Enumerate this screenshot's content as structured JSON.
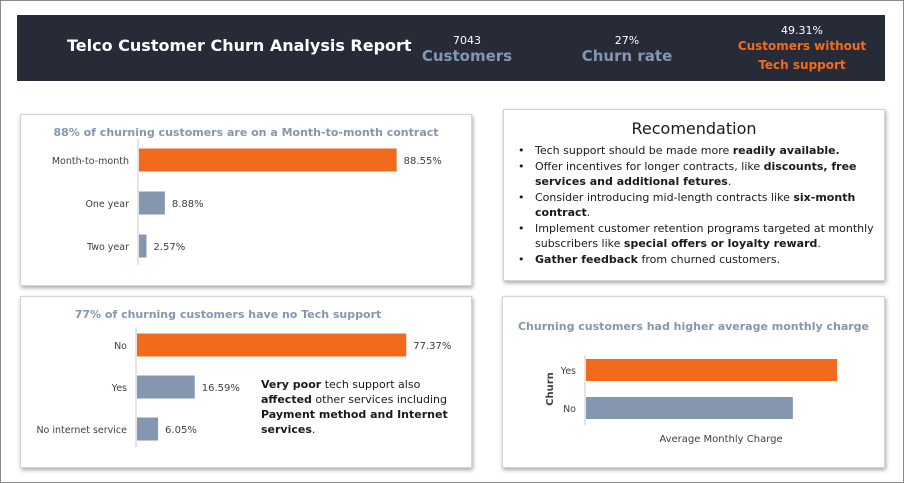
{
  "header": {
    "title": "Telco Customer Churn Analysis Report",
    "kpis": [
      {
        "value": "7043",
        "label": "Customers"
      },
      {
        "value": "27%",
        "label": "Churn rate"
      },
      {
        "value": "49.31%",
        "label_line1": "Customers without",
        "label_line2": "Tech support"
      }
    ]
  },
  "recommendation": {
    "title": "Recomendation",
    "items": [
      {
        "pre": "Tech support should be made more ",
        "bold": "readily available.",
        "post": ""
      },
      {
        "pre": "Offer incentives for longer contracts, like ",
        "bold": "discounts, free services and additional fetures",
        "post": "."
      },
      {
        "pre": "Consider introducing mid-length contracts like ",
        "bold": "six-month contract",
        "post": "."
      },
      {
        "pre": "Implement customer retention programs targeted at monthly subscribers like ",
        "bold": "special offers or loyalty reward",
        "post": "."
      },
      {
        "pre": "",
        "bold": "Gather feedback",
        "post": " from churned customers."
      }
    ]
  },
  "tech_note": {
    "b1": "Very poor",
    "t1": " tech support also ",
    "b2": "affected",
    "t2": " other services including ",
    "b3": "Payment method and Internet services",
    "t3": "."
  },
  "colors": {
    "highlight": "#f26b1d",
    "base": "#8496b0",
    "header_bg": "#262b37"
  },
  "chart_data": [
    {
      "type": "bar",
      "orientation": "horizontal",
      "title": "88% of churning customers are on a Month-to-month contract",
      "categories": [
        "Month-to-month",
        "One year",
        "Two year"
      ],
      "values": [
        88.55,
        8.88,
        2.57
      ],
      "labels": [
        "88.55%",
        "8.88%",
        "2.57%"
      ],
      "xlim": [
        0,
        100
      ],
      "grid": false
    },
    {
      "type": "bar",
      "orientation": "horizontal",
      "title": "77% of churning customers have no Tech support",
      "categories": [
        "No",
        "Yes",
        "No internet service"
      ],
      "values": [
        77.37,
        16.59,
        6.05
      ],
      "labels": [
        "77.37%",
        "16.59%",
        "6.05%"
      ],
      "xlim": [
        0,
        100
      ],
      "grid": false
    },
    {
      "type": "bar",
      "orientation": "horizontal",
      "title": "Churning customers had higher average monthly charge",
      "categories": [
        "Yes",
        "No"
      ],
      "values": [
        74.4,
        61.3
      ],
      "xlabel": "Average Monthly Charge",
      "ylabel": "Churn",
      "xlim": [
        0,
        80
      ],
      "grid": false
    }
  ]
}
